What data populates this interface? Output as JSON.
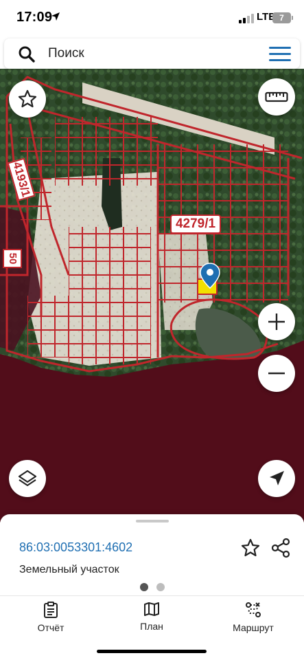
{
  "status_bar": {
    "time": "17:09",
    "network": "LTE",
    "battery": "7"
  },
  "search": {
    "placeholder": "Поиск"
  },
  "map": {
    "labels": {
      "left_parcel": "4193/1",
      "center_parcel": "4279/1",
      "small_parcel": "50"
    },
    "colors": {
      "boundary": "#c0262c",
      "water": "#520d1a",
      "selected_parcel": "#f2e000"
    }
  },
  "selected_object": {
    "cadastral_number": "86:03:0053301:4602",
    "type": "Земельный участок"
  },
  "tabs": [
    {
      "label": "Отчёт",
      "icon": "clipboard-icon"
    },
    {
      "label": "План",
      "icon": "map-icon"
    },
    {
      "label": "Маршрут",
      "icon": "route-icon"
    }
  ],
  "accent_color": "#1f6fb2"
}
